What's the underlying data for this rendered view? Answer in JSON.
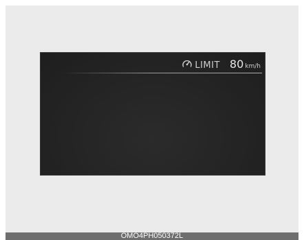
{
  "cluster": {
    "limit_label": "LIMIT",
    "speed_value": "80",
    "speed_unit": "km/h",
    "icon": "speed-limit-gauge-icon"
  },
  "footer": {
    "code": "OMO4PH050372L"
  }
}
